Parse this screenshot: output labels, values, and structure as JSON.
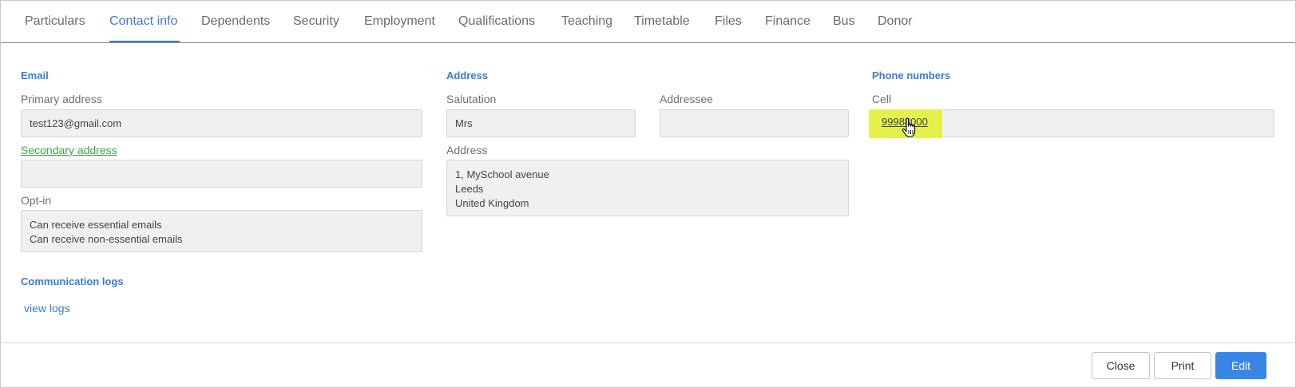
{
  "tabs": [
    {
      "label": "Particulars"
    },
    {
      "label": "Contact info"
    },
    {
      "label": "Dependents"
    },
    {
      "label": "Security"
    },
    {
      "label": "Employment"
    },
    {
      "label": "Qualifications"
    },
    {
      "label": "Teaching"
    },
    {
      "label": "Timetable"
    },
    {
      "label": "Files"
    },
    {
      "label": "Finance"
    },
    {
      "label": "Bus"
    },
    {
      "label": "Donor"
    }
  ],
  "active_tab": "Contact info",
  "email": {
    "title": "Email",
    "primary_label": "Primary address",
    "primary_value": "test123@gmail.com",
    "secondary_label": "Secondary address",
    "secondary_value": "",
    "optin_label": "Opt-in",
    "optin_lines": [
      "Can receive essential emails",
      "Can receive non-essential emails"
    ]
  },
  "communication": {
    "title": "Communication logs",
    "view_logs": "view logs"
  },
  "address": {
    "title": "Address",
    "salutation_label": "Salutation",
    "salutation_value": "Mrs",
    "addressee_label": "Addressee",
    "addressee_value": "",
    "address_label": "Address",
    "address_lines": [
      "1, MySchool avenue",
      "Leeds",
      "United Kingdom"
    ]
  },
  "phone": {
    "title": "Phone numbers",
    "cell_label": "Cell",
    "cell_value": "99988000",
    "highlight_color": "#e5f04a"
  },
  "footer": {
    "close_label": "Close",
    "print_label": "Print",
    "edit_label": "Edit"
  },
  "colors": {
    "accent": "#3a7bd5",
    "link_green": "#3ea34a",
    "primary_button": "#3a86e6"
  },
  "icons": {
    "cursor": "hand-pointer-icon"
  }
}
